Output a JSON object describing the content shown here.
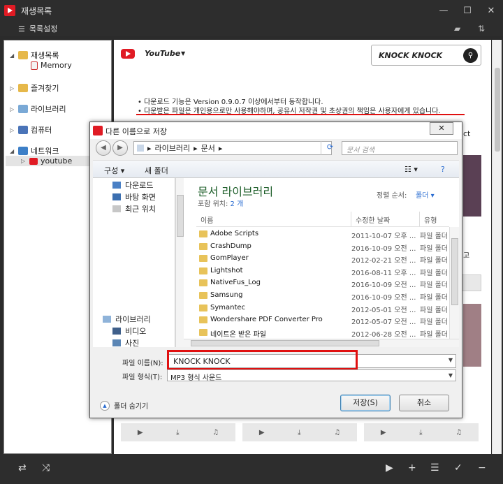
{
  "app": {
    "title": "재생목록"
  },
  "toolbar": {
    "list_settings": "목록설정"
  },
  "tree": {
    "playlist": "재생목록",
    "memory": "Memory",
    "favorites": "즐겨찾기",
    "library": "라이브러리",
    "computer": "컴퓨터",
    "network": "네트워크",
    "youtube": "youtube"
  },
  "content": {
    "service": "YouTube",
    "search_value": "KNOCK KNOCK",
    "notice1": "다운로드 기능은 Version 0.9.0.7 이상에서부터 동작합니다.",
    "notice2": "다운받은 파일은 개인용으로만 사용해야하며, 공유시 저작권 및 초상권의 책임은 사용자에게 있습니다.",
    "partial_text_ct": "ct",
    "partial_text_go": "고"
  },
  "dialog": {
    "title": "다른 이름으로 저장",
    "breadcrumb": [
      "라이브러리",
      "문서"
    ],
    "search_placeholder": "문서 검색",
    "organize": "구성",
    "new_folder": "새 폴더",
    "nav_items": [
      "다운로드",
      "바탕 화면",
      "최근 위치",
      "라이브러리",
      "비디오",
      "사진"
    ],
    "library_title": "문서 라이브러리",
    "include_label": "포함 위치:",
    "include_count": "2 개",
    "sort_label": "정렬 순서:",
    "sort_value": "폴더",
    "columns": {
      "name": "이름",
      "date": "수정한 날짜",
      "type": "유형"
    },
    "files": [
      {
        "name": "Adobe Scripts",
        "date": "2011-10-07 오후 ...",
        "type": "파일 폴더"
      },
      {
        "name": "CrashDump",
        "date": "2016-10-09 오전 ...",
        "type": "파일 폴더"
      },
      {
        "name": "GomPlayer",
        "date": "2012-02-21 오전 ...",
        "type": "파일 폴더"
      },
      {
        "name": "Lightshot",
        "date": "2016-08-11 오후 ...",
        "type": "파일 폴더"
      },
      {
        "name": "NativeFus_Log",
        "date": "2016-10-09 오전 ...",
        "type": "파일 폴더"
      },
      {
        "name": "Samsung",
        "date": "2016-10-09 오전 ...",
        "type": "파일 폴더"
      },
      {
        "name": "Symantec",
        "date": "2012-05-01 오전 ...",
        "type": "파일 폴더"
      },
      {
        "name": "Wondershare PDF Converter Pro",
        "date": "2012-05-07 오전 ...",
        "type": "파일 폴더"
      },
      {
        "name": "네이트온 받은 파일",
        "date": "2012-06-28 오전 ...",
        "type": "파일 폴더"
      }
    ],
    "filename_label": "파일 이름(N):",
    "filename_value": "KNOCK KNOCK",
    "filetype_label": "파일 형식(T):",
    "filetype_value": "MP3 형식 사운드",
    "hide_folders": "폴더 숨기기",
    "save": "저장(S)",
    "cancel": "취소"
  },
  "colors": {
    "accent_red": "#e01010",
    "brand_red": "#e01b24",
    "dark_chrome": "#2d2d2d"
  }
}
